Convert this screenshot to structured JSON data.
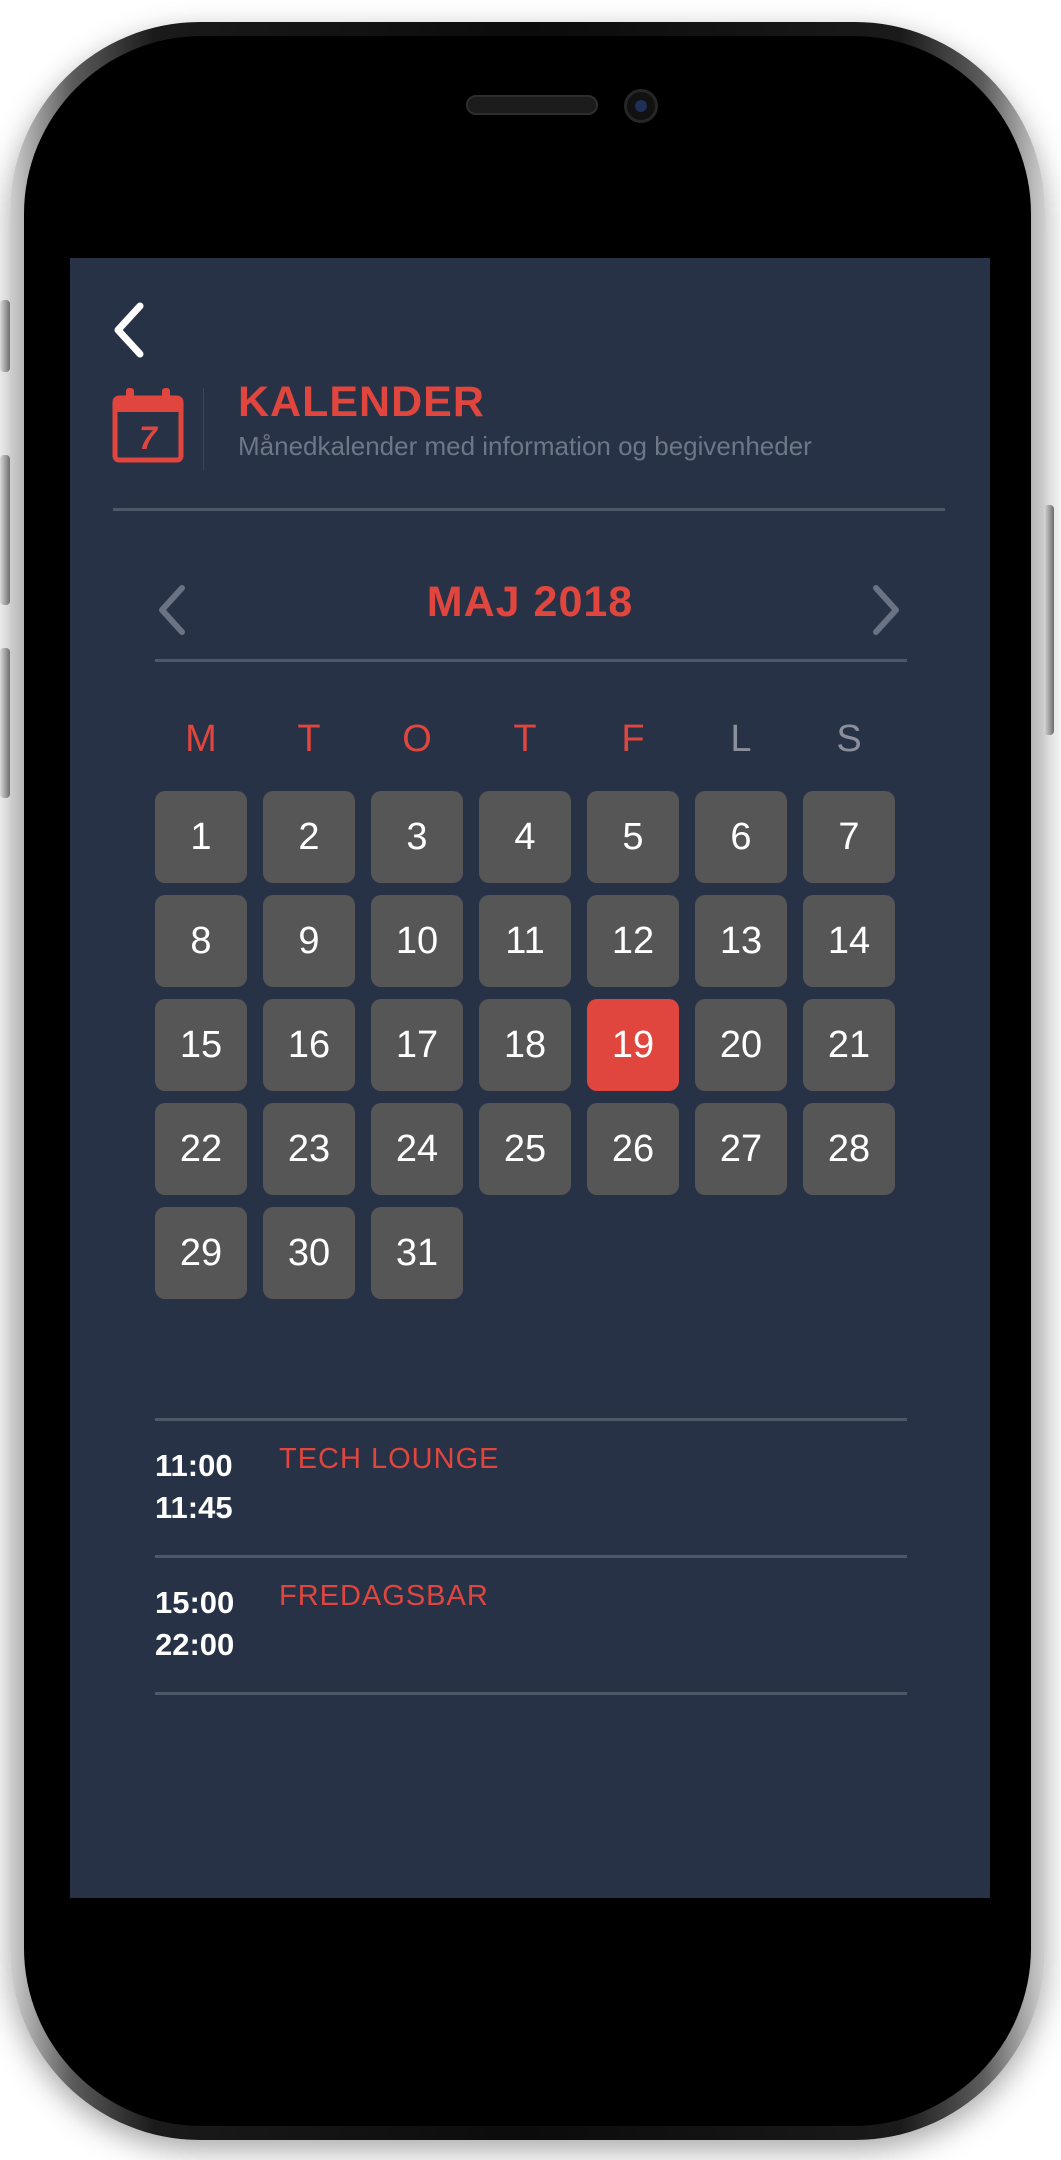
{
  "header": {
    "title": "KALENDER",
    "subtitle": "Månedkalender med information og begivenheder",
    "icon_day": "7",
    "icons": {
      "back": "chevron-left-icon",
      "app": "calendar-icon"
    }
  },
  "calendar": {
    "month_label": "MAJ 2018",
    "weekdays": [
      {
        "label": "M",
        "color": "#e0453e"
      },
      {
        "label": "T",
        "color": "#e0453e"
      },
      {
        "label": "O",
        "color": "#e0453e"
      },
      {
        "label": "T",
        "color": "#e0453e"
      },
      {
        "label": "F",
        "color": "#e0453e"
      },
      {
        "label": "L",
        "color": "#8a8f99"
      },
      {
        "label": "S",
        "color": "#8a8f99"
      }
    ],
    "first_weekday_index": 0,
    "days": [
      "1",
      "2",
      "3",
      "4",
      "5",
      "6",
      "7",
      "8",
      "9",
      "10",
      "11",
      "12",
      "13",
      "14",
      "15",
      "16",
      "17",
      "18",
      "19",
      "20",
      "21",
      "22",
      "23",
      "24",
      "25",
      "26",
      "27",
      "28",
      "29",
      "30",
      "31"
    ],
    "selected_day": "19"
  },
  "events": [
    {
      "start": "11:00",
      "end": "11:45",
      "title": "TECH LOUNGE"
    },
    {
      "start": "15:00",
      "end": "22:00",
      "title": "FREDAGSBAR"
    }
  ],
  "colors": {
    "accent": "#e0453e",
    "background": "#273246",
    "day_tile": "#565656",
    "divider": "#4e5869",
    "weekend_label": "#8a8f99"
  }
}
